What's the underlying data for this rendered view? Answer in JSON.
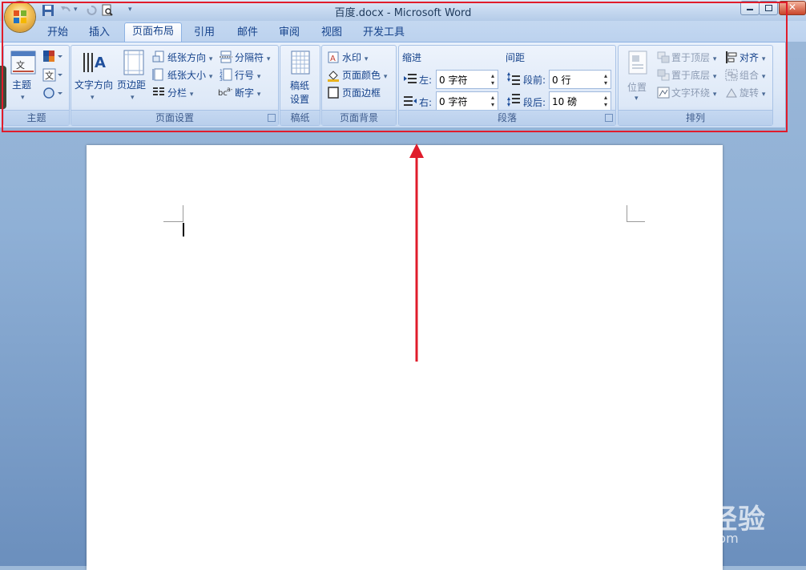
{
  "window": {
    "title": "百度.docx - Microsoft Word"
  },
  "tabs": [
    "开始",
    "插入",
    "页面布局",
    "引用",
    "邮件",
    "审阅",
    "视图",
    "开发工具"
  ],
  "active_tab": "页面布局",
  "groups": {
    "theme": {
      "label": "主题",
      "button": "主题"
    },
    "page_setup": {
      "label": "页面设置",
      "text_direction": "文字方向",
      "margins": "页边距",
      "orientation": "纸张方向",
      "size": "纸张大小",
      "columns": "分栏",
      "breaks": "分隔符",
      "line_numbers": "行号",
      "hyphenation": "断字"
    },
    "manuscript": {
      "label": "稿纸",
      "button_line1": "稿纸",
      "button_line2": "设置"
    },
    "page_background": {
      "label": "页面背景",
      "watermark": "水印",
      "page_color": "页面颜色",
      "page_borders": "页面边框"
    },
    "paragraph": {
      "label": "段落",
      "indent_title": "缩进",
      "spacing_title": "间距",
      "left_label": "左:",
      "left_value": "0 字符",
      "right_label": "右:",
      "right_value": "0 字符",
      "before_label": "段前:",
      "before_value": "0 行",
      "after_label": "段后:",
      "after_value": "10 磅"
    },
    "arrange": {
      "label": "排列",
      "position": "位置",
      "bring_front": "置于顶层",
      "send_back": "置于底层",
      "text_wrap": "文字环绕",
      "align": "对齐",
      "group": "组合",
      "rotate": "旋转"
    }
  },
  "watermark_text": {
    "brand": "Baidu经验",
    "url": "jingyan.baidu.com"
  },
  "colors": {
    "highlight": "#e01c2b",
    "ribbon_text": "#15428b"
  }
}
